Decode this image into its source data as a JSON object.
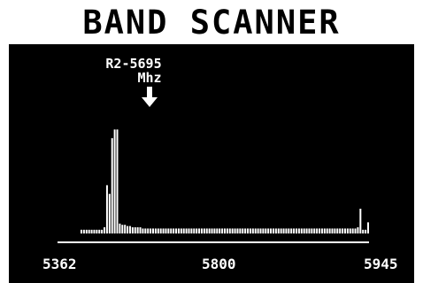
{
  "screen": {
    "title": "BAND SCANNER"
  },
  "marker": {
    "channel_label": "R2-5695",
    "unit_label": "Mhz",
    "icon": "down-arrow-icon"
  },
  "colors": {
    "background": "#000000",
    "foreground": "#ffffff"
  },
  "chart_data": {
    "type": "bar",
    "x_ticks": [
      "5362",
      "5800",
      "5945"
    ],
    "xlim": [
      5362,
      5945
    ],
    "ylim": [
      0,
      100
    ],
    "grid": false,
    "values": [
      3,
      3,
      3,
      3,
      3,
      3,
      3,
      3,
      3,
      5,
      39,
      32,
      77,
      84,
      84,
      8,
      7,
      7,
      6,
      6,
      5,
      5,
      5,
      5,
      4,
      4,
      4,
      4,
      4,
      4,
      4,
      4,
      4,
      4,
      4,
      4,
      4,
      4,
      4,
      4,
      4,
      4,
      4,
      4,
      4,
      4,
      4,
      4,
      4,
      4,
      4,
      4,
      4,
      4,
      4,
      4,
      4,
      4,
      4,
      4,
      4,
      4,
      4,
      4,
      4,
      4,
      4,
      4,
      4,
      4,
      4,
      4,
      4,
      4,
      4,
      4,
      4,
      4,
      4,
      4,
      4,
      4,
      4,
      4,
      4,
      4,
      4,
      4,
      4,
      4,
      4,
      4,
      4,
      4,
      4,
      4,
      4,
      4,
      4,
      4,
      4,
      4,
      4,
      4,
      4,
      4,
      4,
      4,
      5,
      20,
      3,
      3,
      9
    ]
  }
}
